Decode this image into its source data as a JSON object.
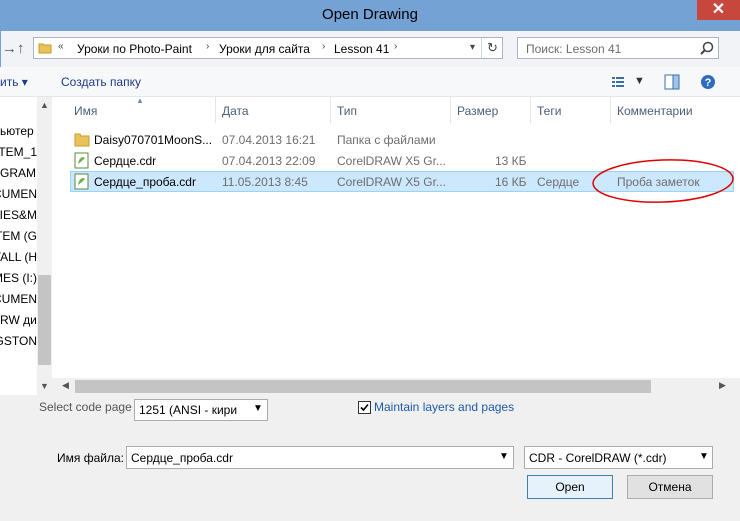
{
  "window": {
    "title": "Open Drawing",
    "close_glyph": "✕"
  },
  "nav": {
    "back_glyph": "←",
    "forward_glyph": "→",
    "up_glyph": "↑",
    "refresh_glyph": "↻"
  },
  "address": {
    "overflow_glyph": "«",
    "crumbs": [
      "Уроки по Photo-Paint",
      "Уроки для сайта",
      "Lesson 41"
    ]
  },
  "search": {
    "placeholder": "Поиск: Lesson 41"
  },
  "toolbar": {
    "organize_label": "ить ▾",
    "new_folder_label": "Создать папку"
  },
  "sidebar": {
    "items": [
      "ьютер",
      "TEM_1",
      "GRAM",
      "CUMEN",
      "VIES&M",
      "TEM (G",
      "TALL (H",
      "MES (I:)",
      "CUMEN",
      "RW ди",
      "GSTON"
    ]
  },
  "columns": [
    "Имя",
    "Дата",
    "Тип",
    "Размер",
    "Теги",
    "Комментарии"
  ],
  "files": [
    {
      "name": "Daisy070701MoonS...",
      "date": "07.04.2013 16:21",
      "type": "Папка с файлами",
      "size": "",
      "tags": "",
      "comment": "",
      "icon": "folder-icon"
    },
    {
      "name": "Сердце.cdr",
      "date": "07.04.2013 22:09",
      "type": "CorelDRAW X5 Gr...",
      "size": "13 КБ",
      "tags": "",
      "comment": "",
      "icon": "cdr-file-icon"
    },
    {
      "name": "Сердце_проба.cdr",
      "date": "11.05.2013 8:45",
      "type": "CorelDRAW X5 Gr...",
      "size": "16 КБ",
      "tags": "Сердце",
      "comment": "Проба заметок",
      "icon": "cdr-file-icon"
    }
  ],
  "codepage": {
    "label": "Select code page",
    "value": "1251  (ANSI - кири"
  },
  "maintain_layers": {
    "label": "Maintain layers and pages",
    "checked": true
  },
  "filename": {
    "label": "Имя файла:",
    "value": "Сердце_проба.cdr"
  },
  "filetype": {
    "value": "CDR - CorelDRAW (*.cdr)"
  },
  "buttons": {
    "open": "Open",
    "cancel": "Отмена"
  },
  "colors": {
    "titlebar": "#74a2d4",
    "close": "#c7473c",
    "selection": "#cce8ff",
    "annotation": "#e00000"
  }
}
